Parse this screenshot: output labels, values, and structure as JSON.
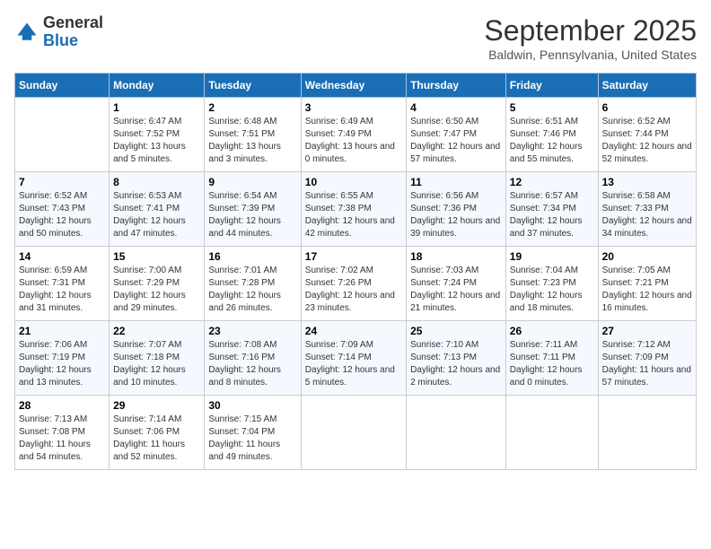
{
  "header": {
    "logo_general": "General",
    "logo_blue": "Blue",
    "title": "September 2025",
    "location": "Baldwin, Pennsylvania, United States"
  },
  "days_of_week": [
    "Sunday",
    "Monday",
    "Tuesday",
    "Wednesday",
    "Thursday",
    "Friday",
    "Saturday"
  ],
  "weeks": [
    [
      {
        "day": "",
        "sunrise": "",
        "sunset": "",
        "daylight": ""
      },
      {
        "day": "1",
        "sunrise": "Sunrise: 6:47 AM",
        "sunset": "Sunset: 7:52 PM",
        "daylight": "Daylight: 13 hours and 5 minutes."
      },
      {
        "day": "2",
        "sunrise": "Sunrise: 6:48 AM",
        "sunset": "Sunset: 7:51 PM",
        "daylight": "Daylight: 13 hours and 3 minutes."
      },
      {
        "day": "3",
        "sunrise": "Sunrise: 6:49 AM",
        "sunset": "Sunset: 7:49 PM",
        "daylight": "Daylight: 13 hours and 0 minutes."
      },
      {
        "day": "4",
        "sunrise": "Sunrise: 6:50 AM",
        "sunset": "Sunset: 7:47 PM",
        "daylight": "Daylight: 12 hours and 57 minutes."
      },
      {
        "day": "5",
        "sunrise": "Sunrise: 6:51 AM",
        "sunset": "Sunset: 7:46 PM",
        "daylight": "Daylight: 12 hours and 55 minutes."
      },
      {
        "day": "6",
        "sunrise": "Sunrise: 6:52 AM",
        "sunset": "Sunset: 7:44 PM",
        "daylight": "Daylight: 12 hours and 52 minutes."
      }
    ],
    [
      {
        "day": "7",
        "sunrise": "Sunrise: 6:52 AM",
        "sunset": "Sunset: 7:43 PM",
        "daylight": "Daylight: 12 hours and 50 minutes."
      },
      {
        "day": "8",
        "sunrise": "Sunrise: 6:53 AM",
        "sunset": "Sunset: 7:41 PM",
        "daylight": "Daylight: 12 hours and 47 minutes."
      },
      {
        "day": "9",
        "sunrise": "Sunrise: 6:54 AM",
        "sunset": "Sunset: 7:39 PM",
        "daylight": "Daylight: 12 hours and 44 minutes."
      },
      {
        "day": "10",
        "sunrise": "Sunrise: 6:55 AM",
        "sunset": "Sunset: 7:38 PM",
        "daylight": "Daylight: 12 hours and 42 minutes."
      },
      {
        "day": "11",
        "sunrise": "Sunrise: 6:56 AM",
        "sunset": "Sunset: 7:36 PM",
        "daylight": "Daylight: 12 hours and 39 minutes."
      },
      {
        "day": "12",
        "sunrise": "Sunrise: 6:57 AM",
        "sunset": "Sunset: 7:34 PM",
        "daylight": "Daylight: 12 hours and 37 minutes."
      },
      {
        "day": "13",
        "sunrise": "Sunrise: 6:58 AM",
        "sunset": "Sunset: 7:33 PM",
        "daylight": "Daylight: 12 hours and 34 minutes."
      }
    ],
    [
      {
        "day": "14",
        "sunrise": "Sunrise: 6:59 AM",
        "sunset": "Sunset: 7:31 PM",
        "daylight": "Daylight: 12 hours and 31 minutes."
      },
      {
        "day": "15",
        "sunrise": "Sunrise: 7:00 AM",
        "sunset": "Sunset: 7:29 PM",
        "daylight": "Daylight: 12 hours and 29 minutes."
      },
      {
        "day": "16",
        "sunrise": "Sunrise: 7:01 AM",
        "sunset": "Sunset: 7:28 PM",
        "daylight": "Daylight: 12 hours and 26 minutes."
      },
      {
        "day": "17",
        "sunrise": "Sunrise: 7:02 AM",
        "sunset": "Sunset: 7:26 PM",
        "daylight": "Daylight: 12 hours and 23 minutes."
      },
      {
        "day": "18",
        "sunrise": "Sunrise: 7:03 AM",
        "sunset": "Sunset: 7:24 PM",
        "daylight": "Daylight: 12 hours and 21 minutes."
      },
      {
        "day": "19",
        "sunrise": "Sunrise: 7:04 AM",
        "sunset": "Sunset: 7:23 PM",
        "daylight": "Daylight: 12 hours and 18 minutes."
      },
      {
        "day": "20",
        "sunrise": "Sunrise: 7:05 AM",
        "sunset": "Sunset: 7:21 PM",
        "daylight": "Daylight: 12 hours and 16 minutes."
      }
    ],
    [
      {
        "day": "21",
        "sunrise": "Sunrise: 7:06 AM",
        "sunset": "Sunset: 7:19 PM",
        "daylight": "Daylight: 12 hours and 13 minutes."
      },
      {
        "day": "22",
        "sunrise": "Sunrise: 7:07 AM",
        "sunset": "Sunset: 7:18 PM",
        "daylight": "Daylight: 12 hours and 10 minutes."
      },
      {
        "day": "23",
        "sunrise": "Sunrise: 7:08 AM",
        "sunset": "Sunset: 7:16 PM",
        "daylight": "Daylight: 12 hours and 8 minutes."
      },
      {
        "day": "24",
        "sunrise": "Sunrise: 7:09 AM",
        "sunset": "Sunset: 7:14 PM",
        "daylight": "Daylight: 12 hours and 5 minutes."
      },
      {
        "day": "25",
        "sunrise": "Sunrise: 7:10 AM",
        "sunset": "Sunset: 7:13 PM",
        "daylight": "Daylight: 12 hours and 2 minutes."
      },
      {
        "day": "26",
        "sunrise": "Sunrise: 7:11 AM",
        "sunset": "Sunset: 7:11 PM",
        "daylight": "Daylight: 12 hours and 0 minutes."
      },
      {
        "day": "27",
        "sunrise": "Sunrise: 7:12 AM",
        "sunset": "Sunset: 7:09 PM",
        "daylight": "Daylight: 11 hours and 57 minutes."
      }
    ],
    [
      {
        "day": "28",
        "sunrise": "Sunrise: 7:13 AM",
        "sunset": "Sunset: 7:08 PM",
        "daylight": "Daylight: 11 hours and 54 minutes."
      },
      {
        "day": "29",
        "sunrise": "Sunrise: 7:14 AM",
        "sunset": "Sunset: 7:06 PM",
        "daylight": "Daylight: 11 hours and 52 minutes."
      },
      {
        "day": "30",
        "sunrise": "Sunrise: 7:15 AM",
        "sunset": "Sunset: 7:04 PM",
        "daylight": "Daylight: 11 hours and 49 minutes."
      },
      {
        "day": "",
        "sunrise": "",
        "sunset": "",
        "daylight": ""
      },
      {
        "day": "",
        "sunrise": "",
        "sunset": "",
        "daylight": ""
      },
      {
        "day": "",
        "sunrise": "",
        "sunset": "",
        "daylight": ""
      },
      {
        "day": "",
        "sunrise": "",
        "sunset": "",
        "daylight": ""
      }
    ]
  ]
}
